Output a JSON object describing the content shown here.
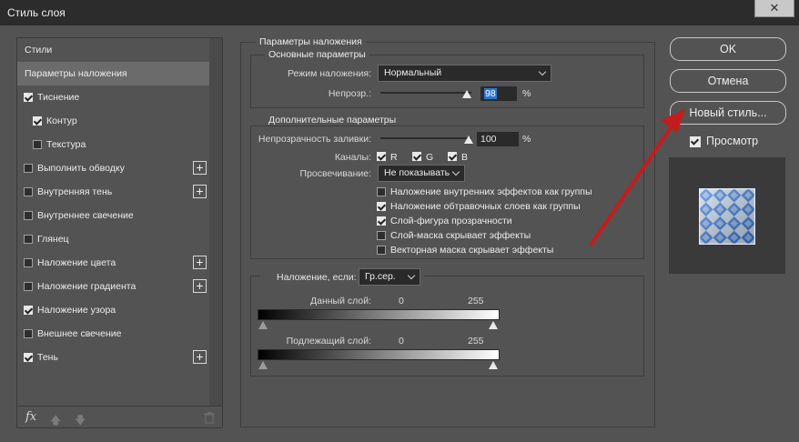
{
  "window": {
    "title": "Стиль слоя",
    "close": "✕"
  },
  "sidebar": {
    "header": "Стили",
    "items": [
      {
        "label": "Параметры наложения",
        "selected": true,
        "checkbox": false
      },
      {
        "label": "Тиснение",
        "checked": true,
        "plus": false
      },
      {
        "label": "Контур",
        "checked": true,
        "plus": false
      },
      {
        "label": "Текстура",
        "checked": false,
        "plus": false
      },
      {
        "label": "Выполнить обводку",
        "checked": false,
        "plus": true
      },
      {
        "label": "Внутренняя тень",
        "checked": false,
        "plus": true
      },
      {
        "label": "Внутреннее свечение",
        "checked": false,
        "plus": false
      },
      {
        "label": "Глянец",
        "checked": false,
        "plus": false
      },
      {
        "label": "Наложение цвета",
        "checked": false,
        "plus": true
      },
      {
        "label": "Наложение градиента",
        "checked": false,
        "plus": true
      },
      {
        "label": "Наложение узора",
        "checked": true,
        "plus": false
      },
      {
        "label": "Внешнее свечение",
        "checked": false,
        "plus": false
      },
      {
        "label": "Тень",
        "checked": true,
        "plus": true
      }
    ],
    "footer": {
      "fx": "fx"
    }
  },
  "blending": {
    "section_title": "Параметры наложения",
    "basic": {
      "title": "Основные параметры",
      "mode_label": "Режим наложения:",
      "mode_value": "Нормальный",
      "opacity_label": "Непрозр.:",
      "opacity_value": "98",
      "opacity_fraction": 0.98,
      "percent": "%"
    },
    "advanced": {
      "title": "Дополнительные параметры",
      "fill_label": "Непрозрачность заливки:",
      "fill_value": "100",
      "fill_fraction": 1.0,
      "percent": "%",
      "channels_label": "Каналы:",
      "channels": [
        "R",
        "G",
        "B"
      ],
      "knockout_label": "Просвечивание:",
      "knockout_value": "Не показывать",
      "options": [
        {
          "label": "Наложение внутренних эффектов как группы",
          "checked": false
        },
        {
          "label": "Наложение обтравочных слоев как группы",
          "checked": true
        },
        {
          "label": "Слой-фигура прозрачности",
          "checked": true
        },
        {
          "label": "Слой-маска скрывает эффекты",
          "checked": false
        },
        {
          "label": "Векторная маска скрывает эффекты",
          "checked": false
        }
      ]
    },
    "blendif": {
      "label": "Наложение, если:",
      "value": "Гр.сер.",
      "this_layer": "Данный слой:",
      "underlying": "Подлежащий слой:",
      "min": "0",
      "max": "255"
    }
  },
  "buttons": {
    "ok": "OK",
    "cancel": "Отмена",
    "new_style": "Новый стиль...",
    "preview": "Просмотр"
  }
}
